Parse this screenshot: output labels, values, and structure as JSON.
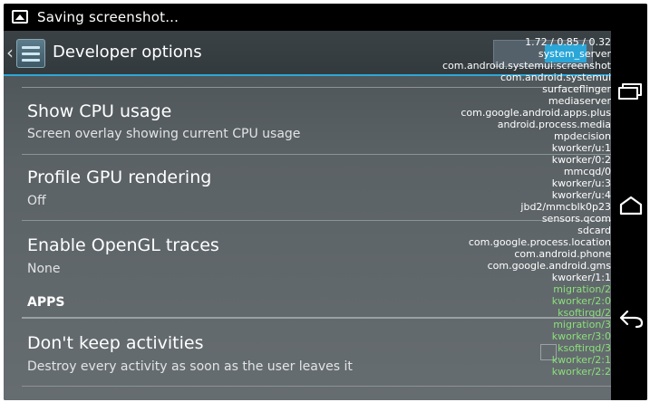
{
  "status_bar": {
    "notification_text": "Saving screenshot...",
    "icon": "image-icon"
  },
  "action_bar": {
    "title": "Developer options",
    "back_icon": "chevron-left-icon",
    "app_icon": "settings-sliders-icon"
  },
  "settings": [
    {
      "title": "Show CPU usage",
      "summary": "Screen overlay showing current CPU usage"
    },
    {
      "title": "Profile GPU rendering",
      "summary": "Off"
    },
    {
      "title": "Enable OpenGL traces",
      "summary": "None"
    }
  ],
  "section_apps": {
    "header": "APPS"
  },
  "apps_settings": [
    {
      "title": "Don't keep activities",
      "summary": "Destroy every activity as soon as the user leaves it"
    }
  ],
  "cpu_overlay": {
    "load": "1.72 / 0.85 / 0.32",
    "processes": [
      {
        "name": "system_server",
        "color": "#ffffff"
      },
      {
        "name": "com.android.systemui:screenshot",
        "color": "#ffffff"
      },
      {
        "name": "com.android.systemui",
        "color": "#ffffff"
      },
      {
        "name": "surfaceflinger",
        "color": "#ffffff"
      },
      {
        "name": "mediaserver",
        "color": "#ffffff"
      },
      {
        "name": "com.google.android.apps.plus",
        "color": "#ffffff"
      },
      {
        "name": "android.process.media",
        "color": "#ffffff"
      },
      {
        "name": "mpdecision",
        "color": "#ffffff"
      },
      {
        "name": "kworker/u:1",
        "color": "#ffffff"
      },
      {
        "name": "kworker/0:2",
        "color": "#ffffff"
      },
      {
        "name": "mmcqd/0",
        "color": "#ffffff"
      },
      {
        "name": "kworker/u:3",
        "color": "#ffffff"
      },
      {
        "name": "kworker/u:4",
        "color": "#ffffff"
      },
      {
        "name": "jbd2/mmcblk0p23",
        "color": "#ffffff"
      },
      {
        "name": "sensors.qcom",
        "color": "#ffffff"
      },
      {
        "name": "sdcard",
        "color": "#ffffff"
      },
      {
        "name": "com.google.process.location",
        "color": "#ffffff"
      },
      {
        "name": "com.android.phone",
        "color": "#ffffff"
      },
      {
        "name": "com.google.android.gms",
        "color": "#ffffff"
      },
      {
        "name": "kworker/1:1",
        "color": "#ffffff"
      },
      {
        "name": "migration/2",
        "color": "#8be07a"
      },
      {
        "name": "kworker/2:0",
        "color": "#8be07a"
      },
      {
        "name": "ksoftirqd/2",
        "color": "#8be07a"
      },
      {
        "name": "migration/3",
        "color": "#8be07a"
      },
      {
        "name": "kworker/3:0",
        "color": "#8be07a"
      },
      {
        "name": "ksoftirqd/3",
        "color": "#8be07a"
      },
      {
        "name": "kworker/2:1",
        "color": "#8be07a"
      },
      {
        "name": "kworker/2:2",
        "color": "#8be07a"
      }
    ]
  },
  "nav_bar": {
    "recents_icon": "recents-icon",
    "home_icon": "home-icon",
    "back_icon": "back-arrow-icon"
  },
  "colors": {
    "accent": "#2ea7d8",
    "background": "#5b6266",
    "overlay_active_process": "#8be07a"
  }
}
